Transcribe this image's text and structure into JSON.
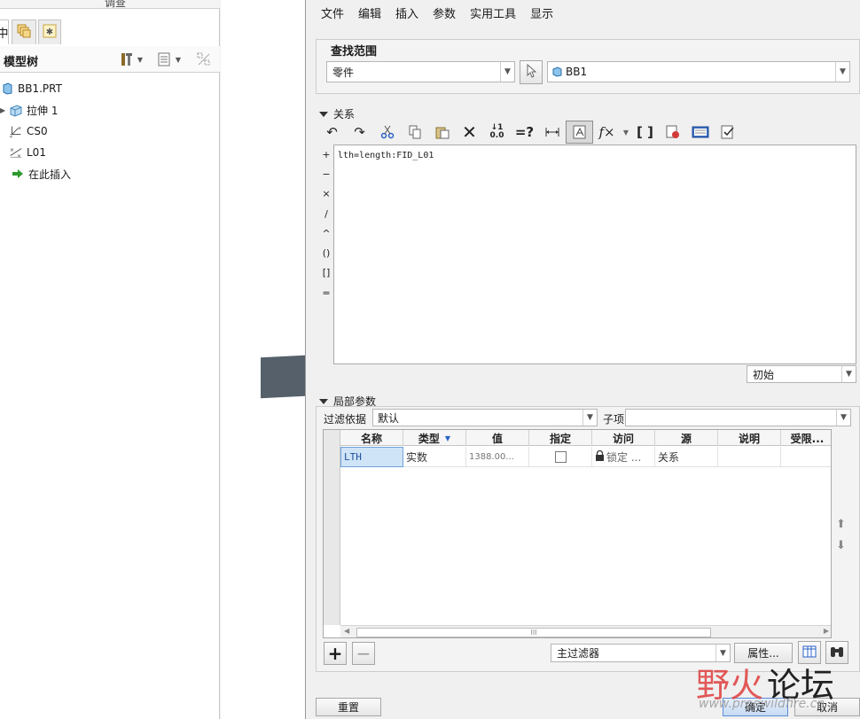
{
  "left_panel": {
    "top_label": "调查",
    "tabs": [
      {
        "label": "中",
        "icon": "model-tree-tab"
      },
      {
        "label": "",
        "icon": "layer-tab-icon"
      },
      {
        "label": "",
        "icon": "star-tab-icon"
      }
    ],
    "tree_title": "模型树",
    "tree": [
      {
        "label": "BB1.PRT",
        "icon": "part-icon"
      },
      {
        "label": "拉伸 1",
        "icon": "extrude-icon"
      },
      {
        "label": "CS0",
        "icon": "csys-icon"
      },
      {
        "label": "L01",
        "icon": "datum-curve-icon"
      },
      {
        "label": "在此插入",
        "icon": "insert-here-arrow-icon"
      }
    ]
  },
  "dialog": {
    "menu": [
      "文件",
      "编辑",
      "插入",
      "参数",
      "实用工具",
      "显示"
    ],
    "scope": {
      "title": "查找范围",
      "type_value": "零件",
      "object_value": "BB1"
    },
    "relations": {
      "title": "关系",
      "toolbar_icons": [
        "undo-icon",
        "redo-icon",
        "cut-icon",
        "copy-icon",
        "paste-icon",
        "delete-icon",
        "sort-icon",
        "evaluate-icon",
        "dimension-icon",
        "verify-icon",
        "function-icon",
        "function-dropdown-icon",
        "brackets-icon",
        "check-relations-icon",
        "display-icon",
        "sum-icon"
      ],
      "operators": [
        "+",
        "−",
        "×",
        "/",
        "^",
        "()",
        "[]",
        "="
      ],
      "editor_text": "lth=length:FID_L01",
      "state_value": "初始"
    },
    "local_params": {
      "title": "局部参数",
      "filter_label": "过滤依据",
      "filter_value": "默认",
      "child_label": "子项",
      "child_value": "",
      "columns": [
        "名称",
        "类型",
        "值",
        "指定",
        "访问",
        "源",
        "说明",
        "受限..."
      ],
      "rows": [
        {
          "name": "LTH",
          "type": "实数",
          "value": "1388.00...",
          "designated": false,
          "access": "锁定 ...",
          "source": "关系",
          "description": "",
          "restricted": ""
        }
      ],
      "scroll_thumb": "III",
      "filter_select": "主过滤器",
      "properties_label": "属性..."
    },
    "buttons": {
      "reset": "重置",
      "ok": "确定",
      "cancel": "取消"
    },
    "watermark": {
      "brand_red": "野火",
      "brand_black": "论坛",
      "url": "www.proewildfire.cn"
    }
  }
}
